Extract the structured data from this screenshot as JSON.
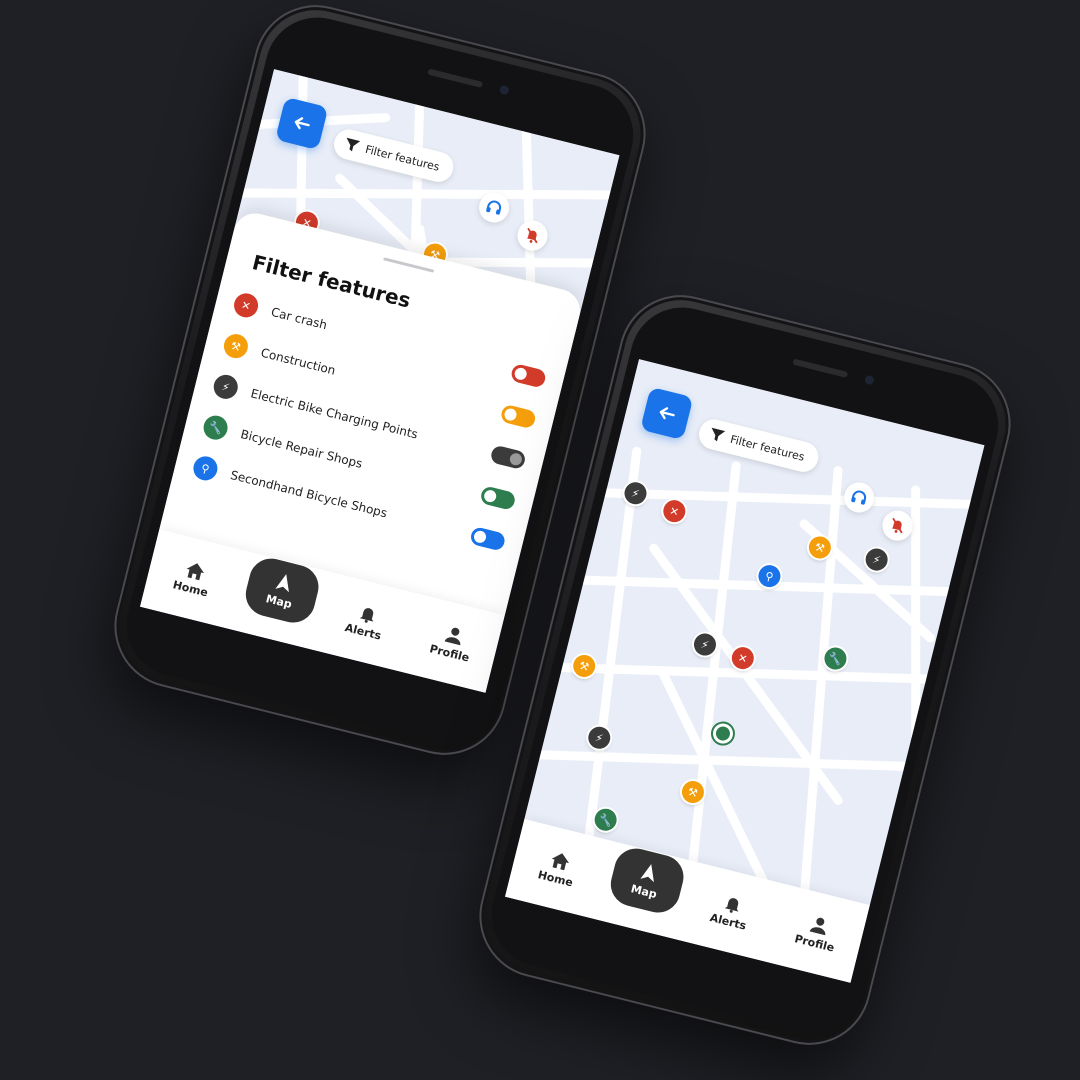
{
  "colors": {
    "background": "#1f2025",
    "accent": "#1a73e8",
    "car_crash": "#d23a2a",
    "construction": "#f59e0b",
    "charging": "#3b3b3b",
    "repair": "#2e7d4f",
    "secondhand": "#1a73e8"
  },
  "phone_left": {
    "filter_pill": {
      "label": "Filter features",
      "icon": "funnel-icon"
    },
    "sheet": {
      "title": "Filter features",
      "features": [
        {
          "label": "Car crash",
          "icon": "car-crash-icon",
          "color": "#d23a2a",
          "toggle": {
            "on": false,
            "color": "#d23a2a"
          }
        },
        {
          "label": "Construction",
          "icon": "construction-icon",
          "color": "#f59e0b",
          "toggle": {
            "on": false,
            "color": "#f59e0b"
          }
        },
        {
          "label": "Electric Bike Charging Points",
          "icon": "charging-icon",
          "color": "#3b3b3b",
          "toggle": {
            "on": true,
            "color": "#3b3b3b"
          }
        },
        {
          "label": "Bicycle Repair Shops",
          "icon": "wrench-icon",
          "color": "#2e7d4f",
          "toggle": {
            "on": false,
            "color": "#2e7d4f"
          }
        },
        {
          "label": "Secondhand Bicycle Shops",
          "icon": "bicycle-icon",
          "color": "#1a73e8",
          "toggle": {
            "on": false,
            "color": "#1a73e8"
          }
        }
      ]
    },
    "nav": [
      {
        "label": "Home",
        "icon": "home-icon"
      },
      {
        "label": "Map",
        "icon": "navigation-arrow-icon"
      },
      {
        "label": "Alerts",
        "icon": "bell-icon"
      },
      {
        "label": "Profile",
        "icon": "person-icon"
      }
    ]
  },
  "phone_right": {
    "filter_pill": {
      "label": "Filter features",
      "icon": "funnel-icon"
    },
    "nav": [
      {
        "label": "Home",
        "icon": "home-icon"
      },
      {
        "label": "Map",
        "icon": "navigation-arrow-icon"
      },
      {
        "label": "Alerts",
        "icon": "bell-icon"
      },
      {
        "label": "Profile",
        "icon": "person-icon"
      }
    ]
  }
}
